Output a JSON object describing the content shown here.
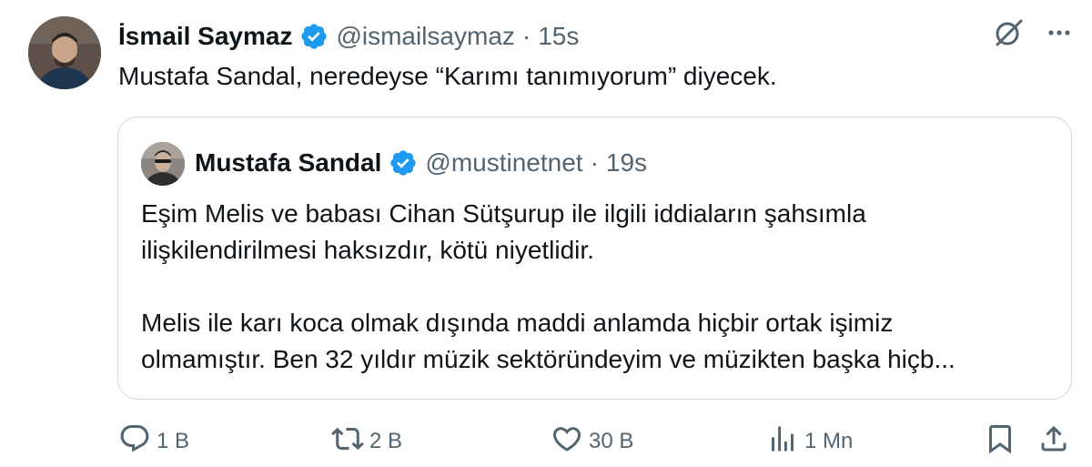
{
  "tweet": {
    "author_name": "İsmail Saymaz",
    "handle": "@ismailsaymaz",
    "separator": "·",
    "time": "15s",
    "text": "Mustafa Sandal, neredeyse “Karımı tanımıyorum” diyecek."
  },
  "quoted": {
    "author_name": "Mustafa Sandal",
    "handle": "@mustinetnet",
    "separator": "·",
    "time": "19s",
    "paragraphs": [
      "Eşim Melis ve babası Cihan Sütşurup ile ilgili iddiaların şahsımla",
      "ilişkilendirilmesi haksızdır, kötü niyetlidir.",
      "Melis ile karı koca olmak dışında maddi anlamda hiçbir ortak işimiz",
      "olmamıştır. Ben 32 yıldır müzik sektöründeyim ve müzikten başka hiçb..."
    ]
  },
  "actions": {
    "replies": "1 B",
    "reposts": "2 B",
    "likes": "30 B",
    "views": "1 Mn"
  },
  "colors": {
    "verified": "#1d9bf0",
    "muted_text": "#536471",
    "primary_text": "#0f1419",
    "border": "#cfd9de"
  },
  "icons": [
    "grok-icon",
    "more-icon",
    "reply-icon",
    "repost-icon",
    "like-icon",
    "views-icon",
    "bookmark-icon",
    "share-icon"
  ]
}
